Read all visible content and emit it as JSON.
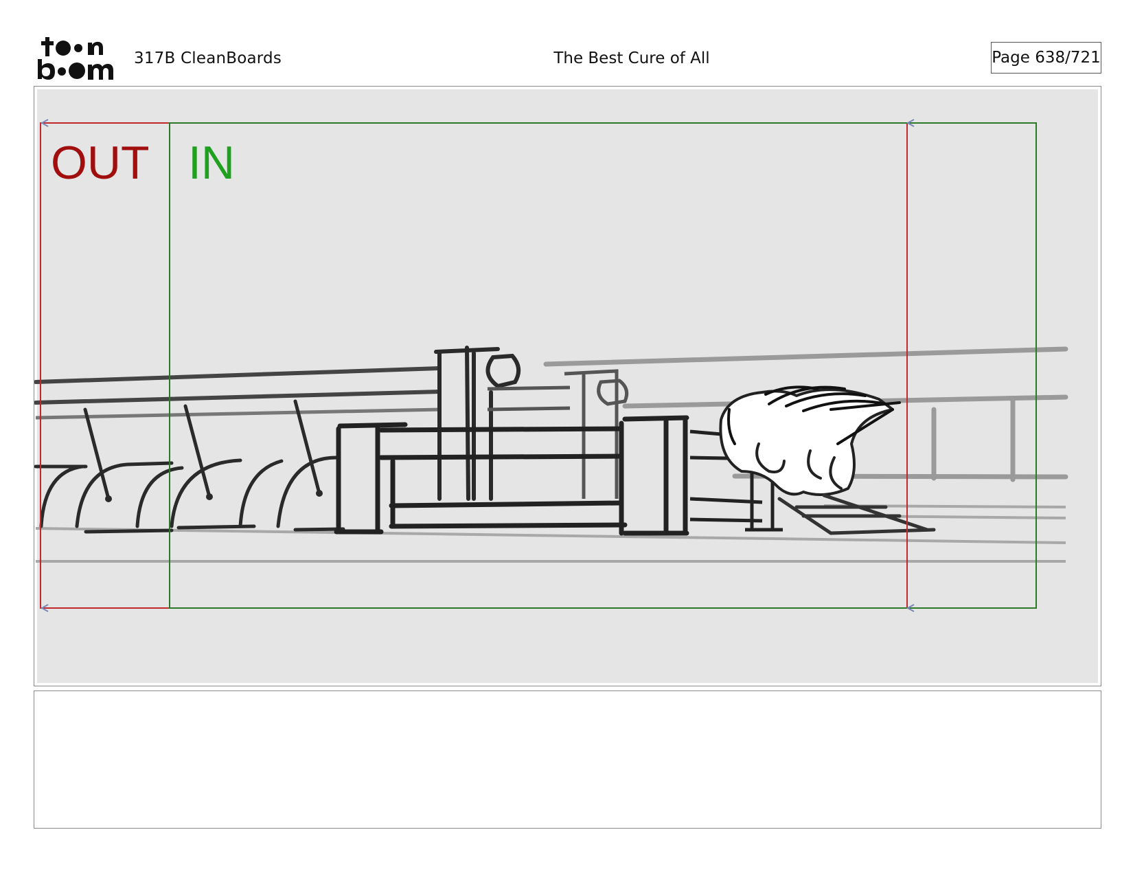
{
  "header": {
    "logo_text": "toon boom",
    "production_code": "317B  CleanBoards",
    "episode_title": "The Best Cure of All",
    "page_label": "Page 638/721"
  },
  "panel": {
    "out_label": "OUT",
    "in_label": "IN",
    "colors": {
      "out_frame": "#c0282d",
      "in_frame": "#2a7a2a",
      "out_text": "#a10e0e",
      "in_text": "#1fa11f",
      "background": "#e5e5e5"
    }
  },
  "notes": {
    "text": ""
  }
}
